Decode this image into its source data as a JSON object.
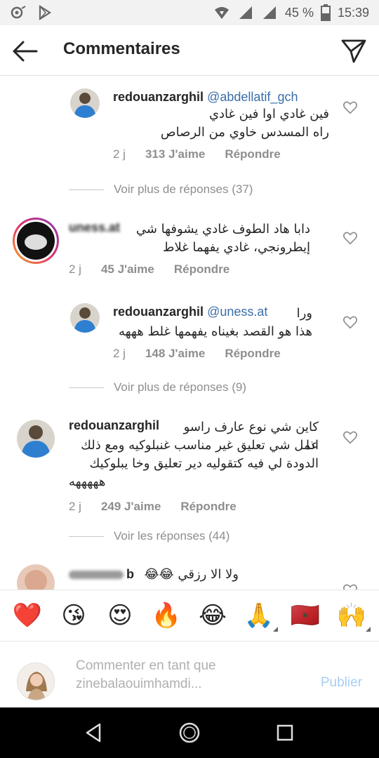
{
  "status_bar": {
    "battery": "45 %",
    "time": "15:39"
  },
  "header": {
    "title": "Commentaires"
  },
  "comments": [
    {
      "username": "redouanzarghil",
      "mention": "@abdellatif_gch",
      "text_lines": [
        "فين غادي اوا فين غادي",
        "راه المسدس خاوي من الرصاص"
      ],
      "time": "2 j",
      "likes": "313 J'aime",
      "reply": "Répondre"
    },
    {
      "username": "uness.at",
      "text_lines": [
        "دابا هاد الطوف غادي يشوفها شي",
        "إيطرونجي، غادي يفهما غلاط"
      ],
      "time": "2 j",
      "likes": "45 J'aime",
      "reply": "Répondre"
    },
    {
      "username": "redouanzarghil",
      "mention": "@uness.at",
      "text_lines": [
        "ورا",
        "هذا هو القصد بغيناه يفهمها غلط هههه"
      ],
      "time": "2 j",
      "likes": "148 J'aime",
      "reply": "Répondre"
    },
    {
      "username": "redouanzarghil",
      "text_lines": [
        "كاين شي نوع عارف راسو اذا",
        "عمل شي تعليق غير مناسب غنبلوكيه ومع ذلك",
        "الدودة لي فيه كتقوليه دير تعليق وخا يبلوكيك",
        "هههههه"
      ],
      "time": "2 j",
      "likes": "249 J'aime",
      "reply": "Répondre"
    },
    {
      "username": "b",
      "text_lines": [
        "ولا الا رزقي 😂😂"
      ]
    }
  ],
  "view_more": [
    "Voir plus de réponses (37)",
    "Voir plus de réponses (9)",
    "Voir les réponses (44)"
  ],
  "emoji_bar": [
    "❤️",
    "😘",
    "😍",
    "🔥",
    "😂",
    "🙏",
    "🇲🇦",
    "🙌"
  ],
  "compose": {
    "placeholder_line1": "Commenter en tant que",
    "placeholder_line2": "zinebalaouimhamdi...",
    "publish": "Publier"
  },
  "colors": {
    "link": "#3b6ea8",
    "muted": "#8e8e8e",
    "publish_disabled": "#a9cdf2"
  }
}
